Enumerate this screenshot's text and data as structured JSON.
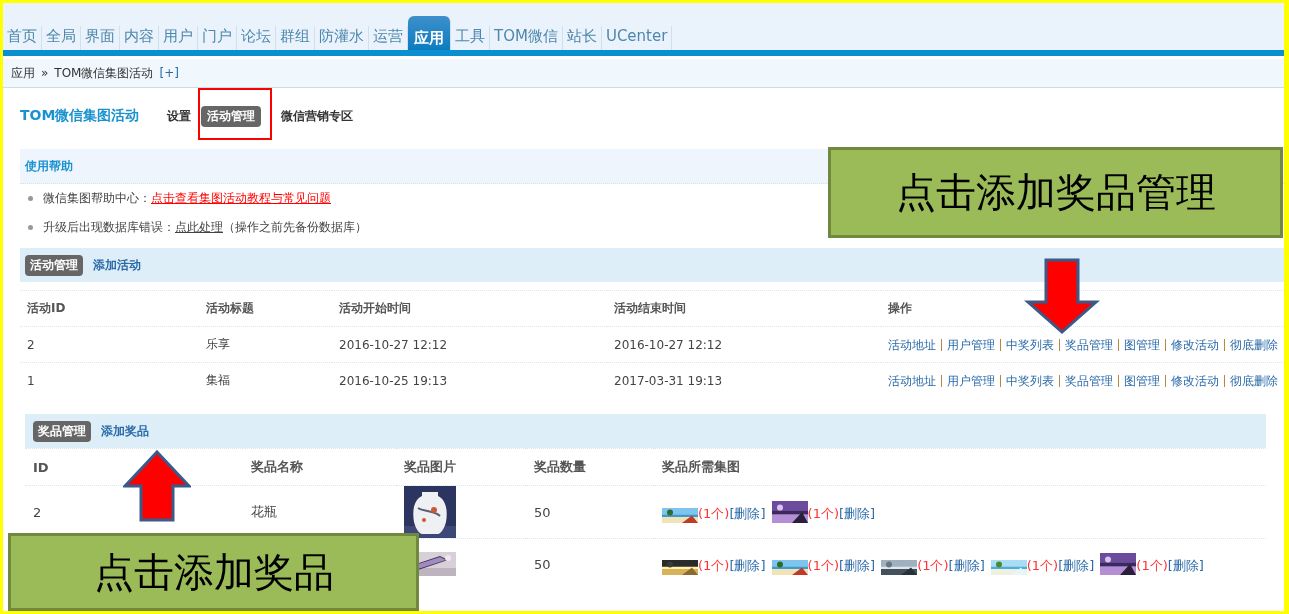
{
  "nav": [
    {
      "label": "首页",
      "selected": false
    },
    {
      "label": "全局",
      "selected": false
    },
    {
      "label": "界面",
      "selected": false
    },
    {
      "label": "内容",
      "selected": false
    },
    {
      "label": "用户",
      "selected": false
    },
    {
      "label": "门户",
      "selected": false
    },
    {
      "label": "论坛",
      "selected": false
    },
    {
      "label": "群组",
      "selected": false
    },
    {
      "label": "防灌水",
      "selected": false
    },
    {
      "label": "运营",
      "selected": false
    },
    {
      "label": "应用",
      "selected": true
    },
    {
      "label": "工具",
      "selected": false
    },
    {
      "label": "TOM微信",
      "selected": false
    },
    {
      "label": "站长",
      "selected": false
    },
    {
      "label": "UCenter",
      "selected": false
    }
  ],
  "breadcrumb": {
    "root": "应用",
    "separator": "»",
    "current": "TOM微信集图活动",
    "add_link": "[+]"
  },
  "plugin": {
    "title": "TOM微信集图活动",
    "tabs": [
      {
        "label": "设置",
        "selected": false
      },
      {
        "label": "活动管理",
        "selected": true
      },
      {
        "label": "微信营销专区",
        "selected": false
      }
    ]
  },
  "help": {
    "title": "使用帮助",
    "items": [
      {
        "label": "微信集图帮助中心：",
        "link": "点击查看集图活动教程与常见问题",
        "kind": "alert"
      },
      {
        "label": "升级后出现数据库错误：",
        "link": "点此处理",
        "note": "（操作之前先备份数据库）",
        "kind": "normal"
      }
    ]
  },
  "activities": {
    "tabs": [
      {
        "label": "活动管理",
        "selected": true
      },
      {
        "label": "添加活动",
        "selected": false
      }
    ],
    "columns": [
      "活动ID",
      "活动标题",
      "活动开始时间",
      "活动结束时间",
      "操作"
    ],
    "rows": [
      {
        "cells": [
          "2",
          "乐享",
          "2016-10-27 12:12",
          "2016-10-27 12:12"
        ],
        "actions": [
          "活动地址",
          "用户管理",
          "中奖列表",
          "奖品管理",
          "图管理",
          "修改活动",
          "彻底删除"
        ]
      },
      {
        "cells": [
          "1",
          "集福",
          "2016-10-25 19:13",
          "2017-03-31 19:13"
        ],
        "actions": [
          "活动地址",
          "用户管理",
          "中奖列表",
          "奖品管理",
          "图管理",
          "修改活动",
          "彻底删除"
        ]
      }
    ]
  },
  "prizes": {
    "tabs": [
      {
        "label": "奖品管理",
        "selected": true
      },
      {
        "label": "添加奖品",
        "selected": false
      }
    ],
    "columns": [
      "ID",
      "奖品名称",
      "奖品图片",
      "奖品数量",
      "奖品所需集图"
    ],
    "rows": [
      {
        "id": "2",
        "name": "花瓶",
        "quantity": "50",
        "pieces": [
          {
            "count": "(1个)",
            "delete": "[删除]"
          },
          {
            "count": "(1个)",
            "delete": "[删除]"
          }
        ]
      },
      {
        "quantity": "50",
        "pieces": [
          {
            "count": "(1个)",
            "delete": "[删除]"
          },
          {
            "count": "(1个)",
            "delete": "[删除]"
          },
          {
            "count": "(1个)",
            "delete": "[删除]"
          },
          {
            "count": "(1个)",
            "delete": "[删除]"
          },
          {
            "count": "(1个)",
            "delete": "[删除]"
          }
        ]
      }
    ]
  },
  "annotations": [
    {
      "text": "点击添加奖品管理",
      "kind": "callout"
    },
    {
      "text": "点击添加奖品",
      "kind": "callout"
    }
  ]
}
